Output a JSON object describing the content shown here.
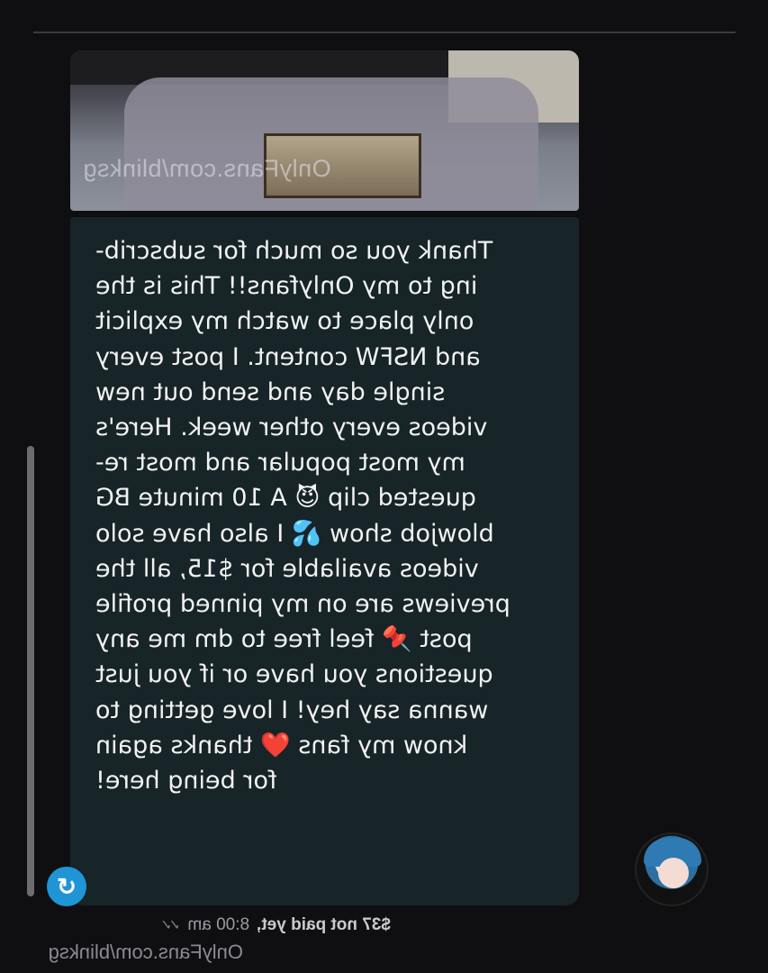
{
  "photo": {
    "watermark": "OnlyFans.com/blinksg"
  },
  "message": {
    "text": "Thank you so much for subscrib-\ning to my Onlyfans!! This is the\nonly place to watch my explicit\nand NSFW content. I post every\nsingle day and send out new\nvideos every other week. Here's\nmy most popular and most re-\nquested clip 😈 A 10 minute BG\nblowjob show 💦 I also have solo\nvideos available for $15, all the\npreviews are on my pinned profile\npost 📌 feel free to dm me any\nquestions you have or if you just\nwanna say hey! I love getting to\nknow my fans ❤️ thanks again\nfor being here!"
  },
  "meta": {
    "price_status": "$37 not paid yet,",
    "time": "8:00 am",
    "ticks": "✓✓"
  },
  "footer": {
    "watermark": "OnlyFans.com/blinksg"
  },
  "icons": {
    "reply": "reply-arrow-icon"
  },
  "colors": {
    "bubble": "#172428",
    "background": "#0f0f12",
    "accent": "#1f95d6"
  }
}
